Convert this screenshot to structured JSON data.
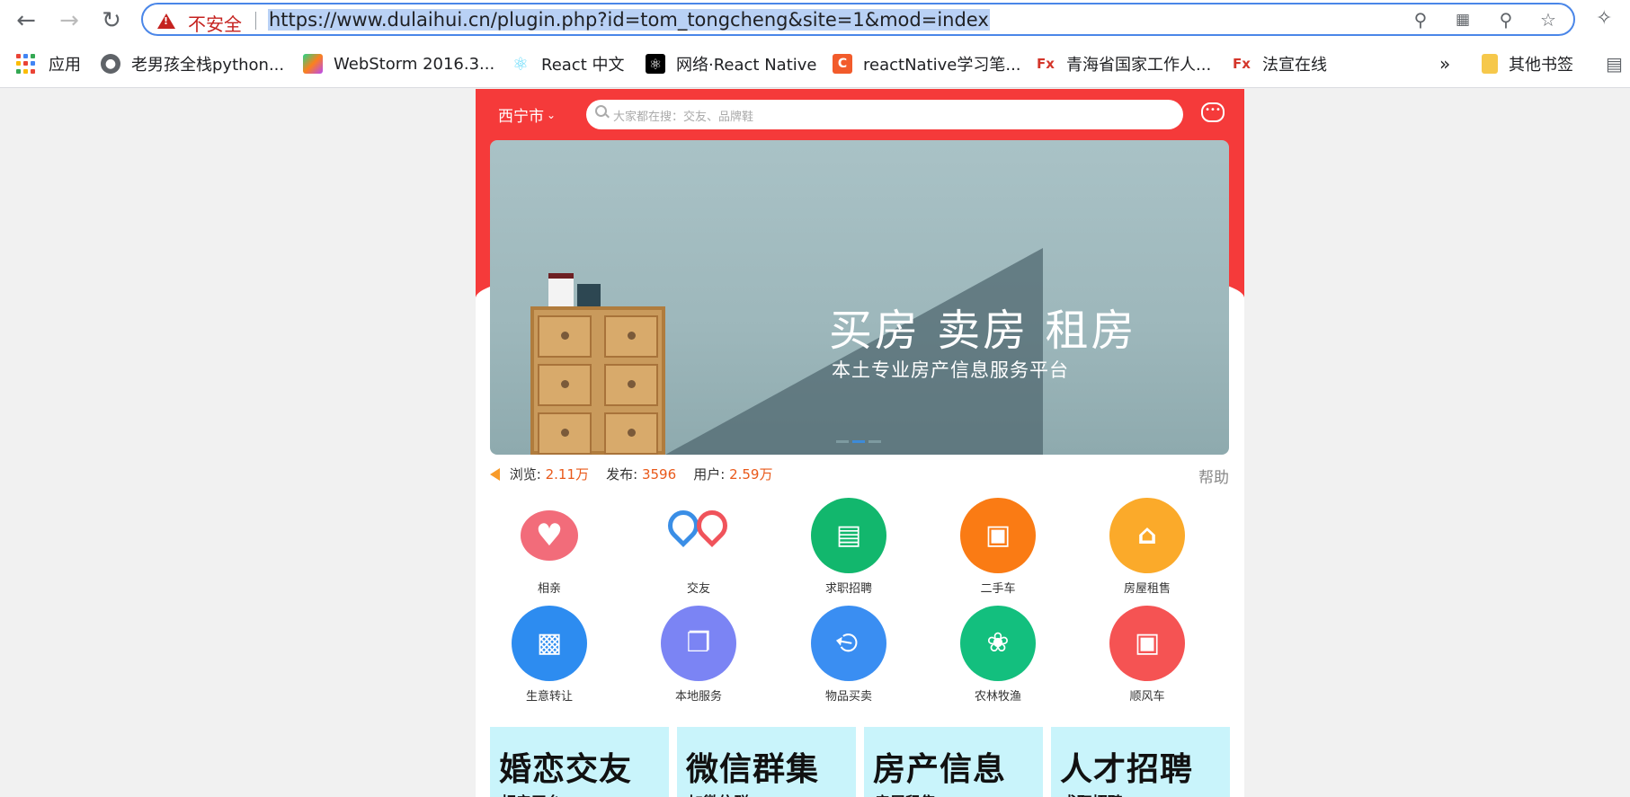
{
  "browser": {
    "security_label": "不安全",
    "url": "https://www.dulaihui.cn/plugin.php?id=tom_tongcheng&site=1&mod=index",
    "icons": [
      "back-icon",
      "forward-icon",
      "reload-icon",
      "warning-icon",
      "location-icon",
      "qr-icon",
      "zoom-icon",
      "star-icon",
      "extensions-icon"
    ]
  },
  "bookmarks": {
    "items": [
      {
        "label": "应用",
        "icon": "apps-icon"
      },
      {
        "label": "老男孩全栈python...",
        "icon": "globe-icon"
      },
      {
        "label": "WebStorm 2016.3...",
        "icon": "webstorm-icon"
      },
      {
        "label": "React 中文",
        "icon": "react-icon"
      },
      {
        "label": "网络·React Native",
        "icon": "react-native-icon"
      },
      {
        "label": "reactNative学习笔...",
        "icon": "csdn-icon"
      },
      {
        "label": "青海省国家工作人...",
        "icon": "fx-icon"
      },
      {
        "label": "法宣在线",
        "icon": "fx-icon"
      }
    ],
    "overflow": "»",
    "other_folder": "其他书签"
  },
  "header": {
    "city": "西宁市",
    "search_placeholder": "大家都在搜：交友、品牌鞋"
  },
  "banner": {
    "title": "买房  卖房  租房",
    "subtitle": "本土专业房产信息服务平台",
    "active_slide": 2,
    "slide_count": 3
  },
  "stats": {
    "views_label": "浏览:",
    "views": "2.11万",
    "posts_label": "发布:",
    "posts": "3596",
    "users_label": "用户:",
    "users": "2.59万",
    "help": "帮助"
  },
  "categories": [
    {
      "label": "相亲",
      "color": "#f26c7a",
      "icon": "heart-icon"
    },
    {
      "label": "交友",
      "color": "#ffffff",
      "icon": "friends-icon"
    },
    {
      "label": "求职招聘",
      "color": "#12b76d",
      "icon": "id-card-icon"
    },
    {
      "label": "二手车",
      "color": "#fa7b14",
      "icon": "car-icon"
    },
    {
      "label": "房屋租售",
      "color": "#fbaa2a",
      "icon": "house-icon"
    },
    {
      "label": "生意转让",
      "color": "#2d8cf0",
      "icon": "shop-icon"
    },
    {
      "label": "本地服务",
      "color": "#7b84f4",
      "icon": "docs-icon"
    },
    {
      "label": "物品买卖",
      "color": "#3a8ef2",
      "icon": "tag-icon"
    },
    {
      "label": "农林牧渔",
      "color": "#13bf7e",
      "icon": "sprout-icon"
    },
    {
      "label": "顺风车",
      "color": "#f55353",
      "icon": "car-icon"
    }
  ],
  "cards": [
    {
      "title": "婚恋交友",
      "subtitle": "相亲平台"
    },
    {
      "title": "微信群集",
      "subtitle": "加微信群"
    },
    {
      "title": "房产信息",
      "subtitle": "房屋租售"
    },
    {
      "title": "人才招聘",
      "subtitle": "求职招聘"
    }
  ]
}
